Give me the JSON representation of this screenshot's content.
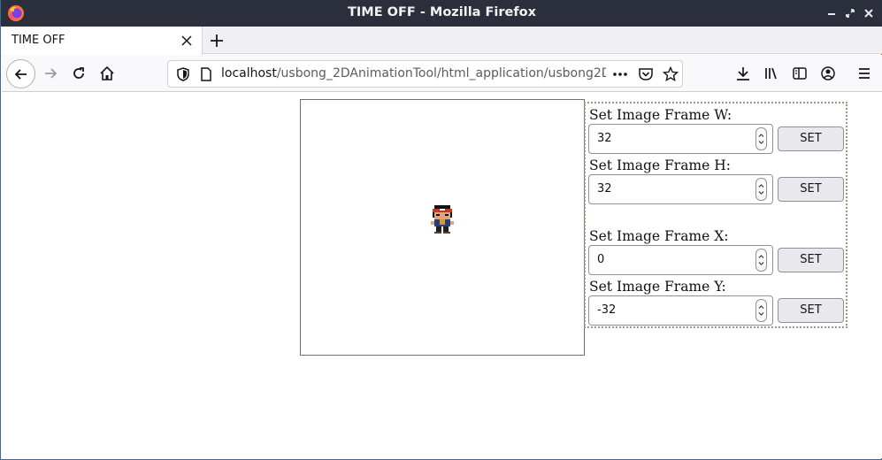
{
  "window": {
    "title": "TIME OFF - Mozilla Firefox",
    "controls": [
      "minimize-icon",
      "restore-icon",
      "close-icon"
    ]
  },
  "tabs": [
    {
      "label": "TIME OFF",
      "active": true
    }
  ],
  "navbar": {
    "url_host": "localhost",
    "url_path": "/usbong_2DAnimationTool/html_application/usbong2D",
    "icons": [
      "back-icon",
      "forward-icon",
      "reload-icon",
      "home-icon",
      "shield-icon",
      "page-icon",
      "more-icon",
      "pocket-icon",
      "bookmark-star-icon",
      "download-icon",
      "library-icon",
      "sidebar-icon",
      "account-icon",
      "menu-icon"
    ]
  },
  "panel": {
    "fields": [
      {
        "label": "Set Image Frame W:",
        "value": "32",
        "button": "SET"
      },
      {
        "label": "Set Image Frame H:",
        "value": "32",
        "button": "SET"
      },
      {
        "label": "Set Image Frame X:",
        "value": "0",
        "button": "SET"
      },
      {
        "label": "Set Image Frame Y:",
        "value": "-32",
        "button": "SET"
      }
    ]
  },
  "colors": {
    "titlebar": "#2b2e3b",
    "tabstrip": "#f0f0f4",
    "navbar": "#f9f9fb",
    "button": "#e9e9ed"
  }
}
